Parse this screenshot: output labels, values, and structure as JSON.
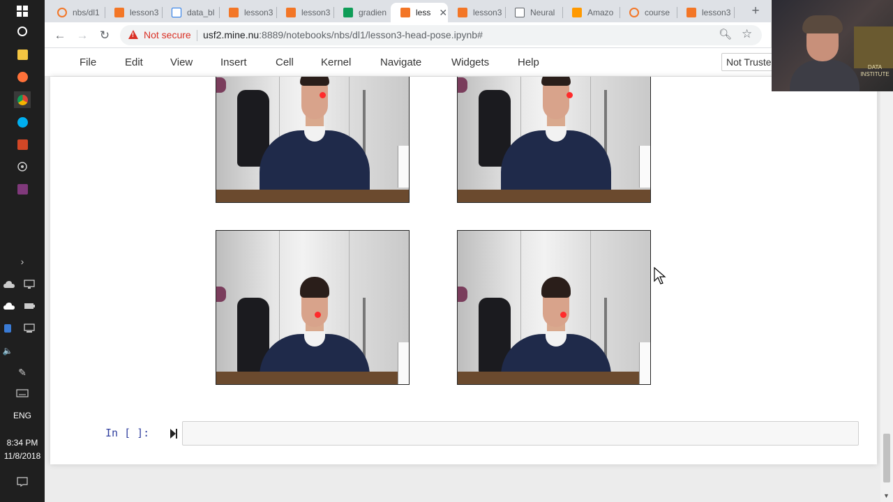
{
  "taskbar": {
    "language": "ENG",
    "time": "8:34 PM",
    "date": "11/8/2018"
  },
  "tabs": [
    {
      "label": "nbs/dl1",
      "icon": "jupyter-icon",
      "color": "#f37626"
    },
    {
      "label": "lesson3",
      "icon": "notebook-icon",
      "color": "#f37626"
    },
    {
      "label": "data_bl",
      "icon": "file-icon",
      "color": "#1a73e8"
    },
    {
      "label": "lesson3",
      "icon": "notebook-icon",
      "color": "#f37626"
    },
    {
      "label": "lesson3",
      "icon": "notebook-icon",
      "color": "#f37626"
    },
    {
      "label": "gradien",
      "icon": "sheets-icon",
      "color": "#0f9d58"
    },
    {
      "label": "less",
      "icon": "notebook-icon",
      "color": "#f37626",
      "active": true
    },
    {
      "label": "lesson3",
      "icon": "notebook-icon",
      "color": "#f37626"
    },
    {
      "label": "Neural",
      "icon": "page-icon",
      "color": "#9aa0a6"
    },
    {
      "label": "Amazo",
      "icon": "aws-icon",
      "color": "#ff9900"
    },
    {
      "label": "course",
      "icon": "jupyter-icon",
      "color": "#f37626"
    },
    {
      "label": "lesson3",
      "icon": "notebook-icon",
      "color": "#f37626"
    }
  ],
  "addressbar": {
    "security_label": "Not secure",
    "url_host": "usf2.mine.nu",
    "url_rest": ":8889/notebooks/nbs/dl1/lesson3-head-pose.ipynb#"
  },
  "menu": {
    "items": [
      "File",
      "Edit",
      "View",
      "Insert",
      "Cell",
      "Kernel",
      "Navigate",
      "Widgets",
      "Help"
    ],
    "trust_label": "Not Truste"
  },
  "cell": {
    "prompt": "In [ ]:"
  },
  "webcam": {
    "sign_text": "DATA INSTITUTE"
  },
  "colors": {
    "warning": "#d93025",
    "prompt": "#303f9f",
    "landmark": "#ff2b2b"
  }
}
